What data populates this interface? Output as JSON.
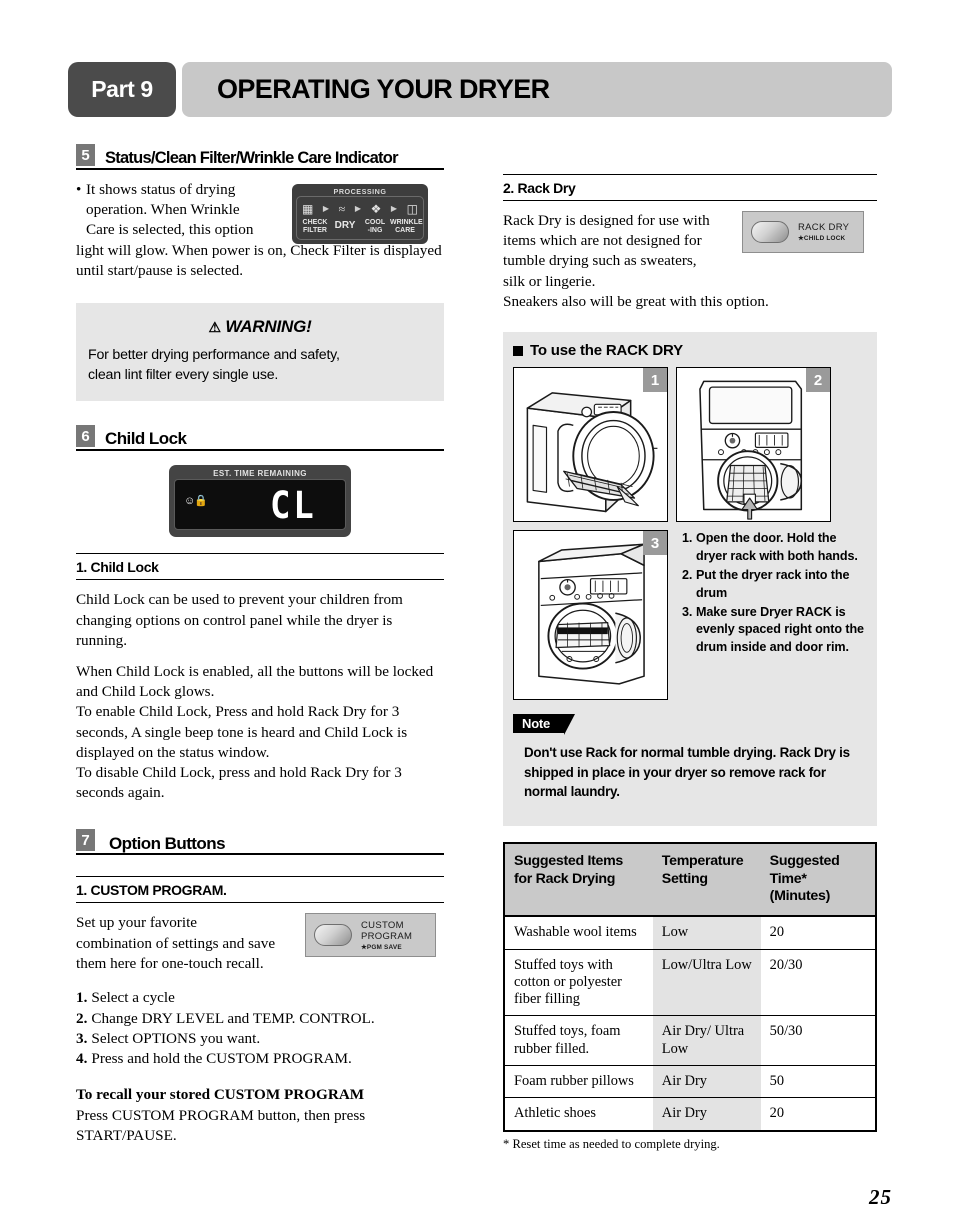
{
  "header": {
    "part_badge": "Part 9",
    "title": "OPERATING YOUR DRYER"
  },
  "left": {
    "section5": {
      "number": "5",
      "title": "Status/Clean Filter/Wrinkle Care Indicator",
      "bullet_line1": "It shows status of drying",
      "bullet_line2": "operation. When Wrinkle",
      "bullet_line3": "Care is selected, this option",
      "bullet_rest": "light will glow. When power is on, Check Filter is displayed until start/pause is selected.",
      "display": {
        "title": "PROCESSING",
        "labels": [
          "CHECK FILTER",
          "DRY",
          "COOL -ING",
          "WRINKLE CARE"
        ],
        "label_check_l1": "CHECK",
        "label_check_l2": "FILTER",
        "label_dry": "DRY",
        "label_cool_l1": "COOL",
        "label_cool_l2": "-ING",
        "label_wrinkle_l1": "WRINKLE",
        "label_wrinkle_l2": "CARE",
        "icons": [
          "filter-icon",
          "dry-waves-icon",
          "cooling-fan-icon",
          "iron-icon"
        ]
      }
    },
    "warning": {
      "triangle": "⚠",
      "title": "WARNING!",
      "line1": "For better drying performance and safety,",
      "line2": "clean lint filter every single use."
    },
    "section6": {
      "number": "6",
      "title": "Child Lock",
      "display": {
        "title": "EST. TIME REMAINING",
        "digits": "CL",
        "icons": "☺ὑ2"
      },
      "sub_head": "1. Child Lock",
      "para1": "Child Lock can be used to prevent your children from changing options on control panel while the dryer is running.",
      "para2_l1": "When Child Lock is enabled, all the buttons will be locked and Child Lock glows.",
      "para2_l2": "To enable Child Lock, Press and hold Rack Dry for 3 seconds, A single beep tone is heard and Child Lock  is displayed on the status window.",
      "para2_l3": "To disable Child Lock, press and hold Rack Dry for 3 seconds again."
    },
    "section7": {
      "number": "7",
      "title": "Option Buttons",
      "sub_head": "1. CUSTOM PROGRAM.",
      "para_l1": "Set up your favorite",
      "para_l2": "combination of settings and save",
      "para_l3": "them here for one-touch recall.",
      "button": {
        "label_l1": "CUSTOM",
        "label_l2": "PROGRAM",
        "sub": "★PGM SAVE"
      },
      "steps": [
        {
          "n": "1.",
          "t": "Select a cycle"
        },
        {
          "n": "2.",
          "t": "Change DRY LEVEL and TEMP. CONTROL."
        },
        {
          "n": "3.",
          "t": "Select OPTIONS you want."
        },
        {
          "n": "4.",
          "t": "Press and hold the CUSTOM PROGRAM."
        }
      ],
      "recall_head": "To recall your stored CUSTOM PROGRAM",
      "recall_body": "Press CUSTOM PROGRAM button, then press START/PAUSE."
    }
  },
  "right": {
    "rack_dry": {
      "sub_head": "2. Rack Dry",
      "para_l1": "Rack Dry is designed for use with",
      "para_l2": "items which are not designed for",
      "para_l3": "tumble drying such as sweaters,",
      "para_l4": "silk or lingerie.",
      "para_l5": "Sneakers also will be great with this option.",
      "button": {
        "label": "RACK DRY",
        "sub": "★CHILD LOCK"
      }
    },
    "use_rack": {
      "head": "To use the RACK DRY",
      "illustrations": [
        {
          "num": "1",
          "alt": "dryer-side-view-rack-pulled-out"
        },
        {
          "num": "2",
          "alt": "dryer-front-view-rack-inserted-arrow"
        },
        {
          "num": "3",
          "alt": "dryer-front-view-rack-seated"
        }
      ],
      "steps": [
        {
          "n": "1.",
          "t": "Open the door. Hold the dryer rack with both hands."
        },
        {
          "n": "2.",
          "t": "Put the dryer rack into the drum"
        },
        {
          "n": "3.",
          "t": "Make sure Dryer RACK is evenly spaced right onto the drum inside and door rim."
        }
      ]
    },
    "note": {
      "tab": "Note",
      "body": "Don't use Rack for normal tumble drying. Rack Dry is shipped in place in your dryer so remove rack for normal laundry."
    },
    "table": {
      "headers": [
        "Suggested Items for Rack Drying",
        "Temperature Setting",
        "Suggested Time* (Minutes)"
      ],
      "header_lines": [
        [
          "Suggested Items",
          "for Rack Drying"
        ],
        [
          "Temperature",
          "Setting"
        ],
        [
          "Suggested",
          "Time*",
          "(Minutes)"
        ]
      ],
      "rows": [
        {
          "item": "Washable wool items",
          "temp": "Low",
          "time": "20"
        },
        {
          "item": "Stuffed toys with cotton or polyester fiber filling",
          "temp": "Low/Ultra Low",
          "time": "20/30"
        },
        {
          "item": "Stuffed toys, foam rubber filled.",
          "temp": "Air Dry/ Ultra Low",
          "time": "50/30"
        },
        {
          "item": "Foam rubber pillows",
          "temp": "Air Dry",
          "time": "50"
        },
        {
          "item": "Athletic shoes",
          "temp": "Air Dry",
          "time": "20"
        }
      ],
      "footnote": "* Reset time as needed to complete drying."
    }
  },
  "page_number": "25",
  "colors": {
    "badge_dark": "#4b4b4b",
    "header_bar": "#c8c8c8",
    "grey_box": "#e6e6e6",
    "table_header": "#c9c9c9",
    "table_col2": "#e3e3e3",
    "illus_num": "#9a9a9a"
  }
}
